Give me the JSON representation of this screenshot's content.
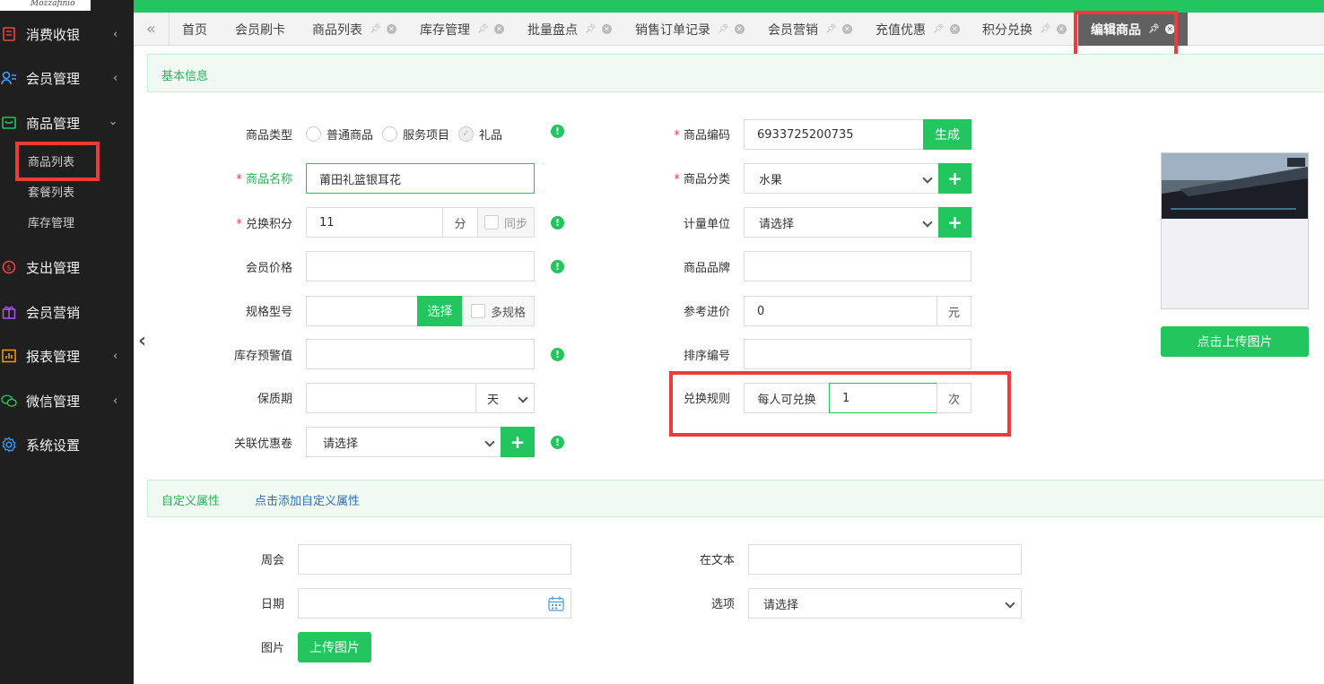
{
  "logo_text": "Mozzafinio",
  "sidebar": {
    "items": [
      {
        "label": "消费收银",
        "icon": "cashier-icon"
      },
      {
        "label": "会员管理",
        "icon": "members-icon"
      },
      {
        "label": "商品管理",
        "icon": "goods-icon"
      },
      {
        "label": "支出管理",
        "icon": "expense-icon"
      },
      {
        "label": "会员营销",
        "icon": "gift-icon"
      },
      {
        "label": "报表管理",
        "icon": "report-icon"
      },
      {
        "label": "微信管理",
        "icon": "wechat-icon"
      },
      {
        "label": "系统设置",
        "icon": "settings-icon"
      }
    ],
    "sub_items": [
      "商品列表",
      "套餐列表",
      "库存管理"
    ],
    "active_sub": "商品列表"
  },
  "tabs": {
    "nav_back": "«",
    "items": [
      "首页",
      "会员刷卡",
      "商品列表",
      "库存管理",
      "批量盘点",
      "销售订单记录",
      "会员营销",
      "充值优惠",
      "积分兑换",
      "编辑商品"
    ],
    "active": "编辑商品"
  },
  "basic_section": {
    "title": "基本信息"
  },
  "form": {
    "product_type": {
      "label": "商品类型",
      "options": [
        "普通商品",
        "服务项目",
        "礼品"
      ],
      "selected": "礼品"
    },
    "product_name": {
      "label": "商品名称",
      "value": "莆田礼篮银耳花"
    },
    "points": {
      "label": "兑换积分",
      "value": "11",
      "unit": "分",
      "sync_label": "同步"
    },
    "member_price": {
      "label": "会员价格",
      "value": ""
    },
    "spec": {
      "label": "规格型号",
      "value": "",
      "select_button": "选择",
      "multi_label": "多规格"
    },
    "stock_warning": {
      "label": "库存预警值",
      "value": ""
    },
    "shelf_life": {
      "label": "保质期",
      "value": "",
      "unit": "天"
    },
    "coupon": {
      "label": "关联优惠卷",
      "placeholder": "请选择"
    },
    "code": {
      "label": "商品编码",
      "value": "6933725200735",
      "generate_button": "生成"
    },
    "category": {
      "label": "商品分类",
      "value": "水果"
    },
    "unit": {
      "label": "计量单位",
      "value": "请选择"
    },
    "brand": {
      "label": "商品品牌",
      "value": ""
    },
    "ref_price": {
      "label": "参考进价",
      "value": "0",
      "unit": "元"
    },
    "sort_no": {
      "label": "排序编号",
      "value": ""
    },
    "exchange_rule": {
      "label": "兑换规则",
      "prefix": "每人可兑换",
      "value": "1",
      "unit": "次"
    },
    "upload_image_button": "点击上传图片"
  },
  "custom_section": {
    "title": "自定义属性",
    "add_link": "点击添加自定义属性"
  },
  "custom_fields": {
    "zhouhui": {
      "label": "周会",
      "value": ""
    },
    "text": {
      "label": "在文本",
      "value": ""
    },
    "date": {
      "label": "日期",
      "value": ""
    },
    "option": {
      "label": "选项",
      "value": "请选择"
    },
    "image": {
      "label": "图片",
      "button": "上传图片"
    }
  },
  "colors": {
    "accent": "#22c55e",
    "highlight": "#ef3b3b",
    "sidebar": "#1f1f1f"
  }
}
